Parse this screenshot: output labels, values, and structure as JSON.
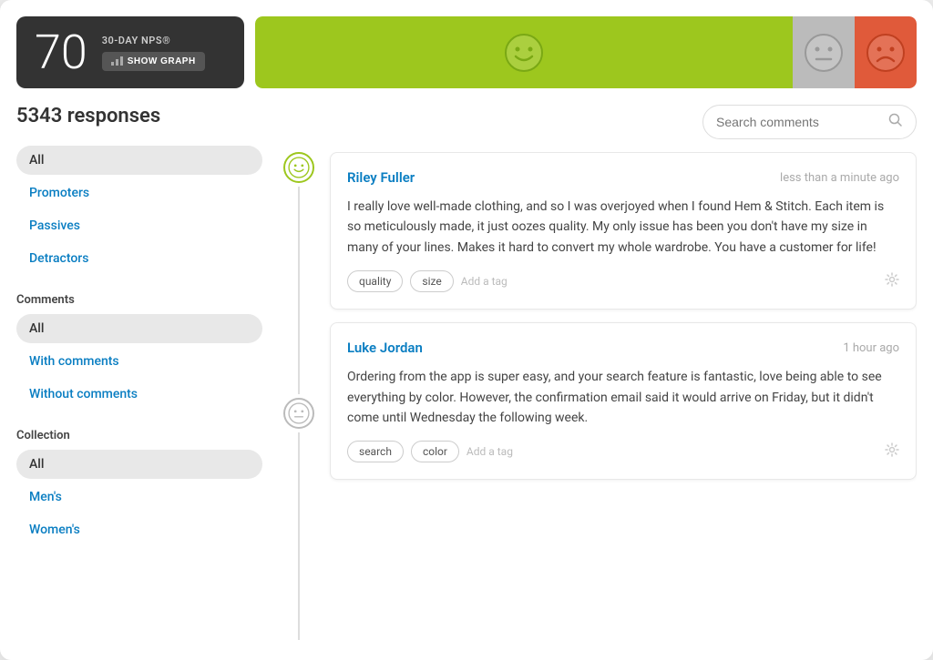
{
  "header": {
    "nps_score": "70",
    "nps_label": "30-DAY NPS®",
    "show_graph_label": "SHOW GRAPH"
  },
  "responses_count": "5343 responses",
  "search": {
    "placeholder": "Search comments"
  },
  "filters": {
    "type_label": "",
    "type_items": [
      {
        "label": "All",
        "active": true
      },
      {
        "label": "Promoters",
        "active": false
      },
      {
        "label": "Passives",
        "active": false
      },
      {
        "label": "Detractors",
        "active": false
      }
    ],
    "comments_label": "Comments",
    "comments_items": [
      {
        "label": "All",
        "active": true
      },
      {
        "label": "With comments",
        "active": false
      },
      {
        "label": "Without comments",
        "active": false
      }
    ],
    "collection_label": "Collection",
    "collection_items": [
      {
        "label": "All",
        "active": true
      },
      {
        "label": "Men's",
        "active": false
      },
      {
        "label": "Women's",
        "active": false
      }
    ]
  },
  "cards": [
    {
      "author": "Riley Fuller",
      "time": "less than a minute ago",
      "body": "I really love well-made clothing, and so I was overjoyed when I found Hem & Stitch. Each item is so meticulously made, it just oozes quality. My only issue has been you don't have my size in many of your lines. Makes it hard to convert my whole wardrobe. You have a customer for life!",
      "tags": [
        "quality",
        "size"
      ],
      "add_tag": "Add a tag",
      "type": "promoter"
    },
    {
      "author": "Luke Jordan",
      "time": "1 hour ago",
      "body": "Ordering from the app is super easy, and your search feature is fantastic, love being able to see everything by color. However, the confirmation email said it would arrive on Friday, but it didn't come until Wednesday the following week.",
      "tags": [
        "search",
        "color"
      ],
      "add_tag": "Add a tag",
      "type": "passive"
    }
  ]
}
